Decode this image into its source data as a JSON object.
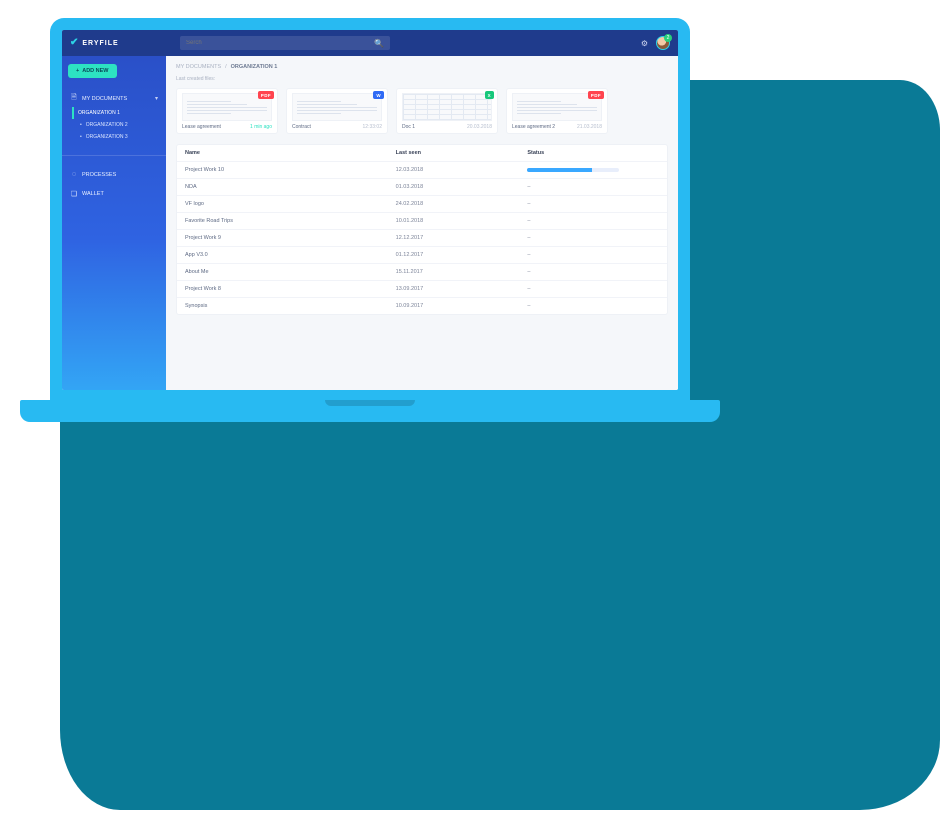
{
  "brand": {
    "name": "ERYFILE"
  },
  "search": {
    "placeholder": "Serch"
  },
  "notifications_count": "2",
  "sidebar": {
    "add_label": "ADD NEW",
    "my_documents": "MY DOCUMENTS",
    "orgs": [
      {
        "label": "ORGANIZATION 1"
      },
      {
        "label": "ORGANIZATION 2"
      },
      {
        "label": "ORGANIZATION 3"
      }
    ],
    "processes": "PROCESSES",
    "wallet": "WALLET"
  },
  "breadcrumb": {
    "parent": "MY DOCUMENTS",
    "separator": "/",
    "current": "ORGANIZATION 1"
  },
  "section_label": "Last created files:",
  "cards": [
    {
      "name": "Lease agreement",
      "date": "1 min ago",
      "badge": "PDF",
      "badge_class": "badge-pdf",
      "accent": true,
      "thumb": "doc"
    },
    {
      "name": "Contract",
      "date": "12:33:02",
      "badge": "W",
      "badge_class": "badge-doc",
      "accent": false,
      "thumb": "doc"
    },
    {
      "name": "Doc 1",
      "date": "20.03.2018",
      "badge": "X",
      "badge_class": "badge-xls",
      "accent": false,
      "thumb": "grid"
    },
    {
      "name": "Lease agreement 2",
      "date": "21.03.2018",
      "badge": "PDF",
      "badge_class": "badge-pdf",
      "accent": false,
      "thumb": "doc"
    }
  ],
  "table": {
    "headers": {
      "name": "Name",
      "last_seen": "Last seen",
      "status": "Status"
    },
    "rows": [
      {
        "name": "Project Work 10",
        "last_seen": "12.03.2018",
        "status_progress": 70
      },
      {
        "name": "NDA",
        "last_seen": "01.03.2018",
        "status_progress": null
      },
      {
        "name": "VF logo",
        "last_seen": "24.02.2018",
        "status_progress": null
      },
      {
        "name": "Favorite Road Trips",
        "last_seen": "10.01.2018",
        "status_progress": null
      },
      {
        "name": "Project Work 9",
        "last_seen": "12.12.2017",
        "status_progress": null
      },
      {
        "name": "App V3.0",
        "last_seen": "01.12.2017",
        "status_progress": null
      },
      {
        "name": "About Me",
        "last_seen": "15.11.2017",
        "status_progress": null
      },
      {
        "name": "Project Work 8",
        "last_seen": "13.09.2017",
        "status_progress": null
      },
      {
        "name": "Synopsis",
        "last_seen": "10.09.2017",
        "status_progress": null
      }
    ]
  }
}
